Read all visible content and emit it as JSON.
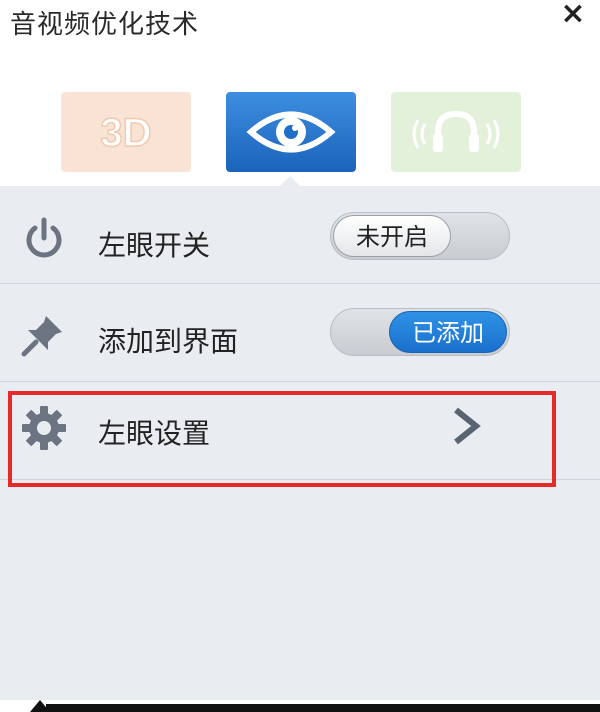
{
  "window": {
    "title": "音视频优化技术",
    "close_label": "×"
  },
  "tabs": [
    {
      "name": "3d-tab",
      "icon": "3d-icon",
      "label": "3D",
      "selected": false,
      "color": "#f9e3d4"
    },
    {
      "name": "eye-tab",
      "icon": "eye-icon",
      "selected": true,
      "color": "#1f6fc8"
    },
    {
      "name": "audio-tab",
      "icon": "headphones-icon",
      "selected": false,
      "color": "#e3f1da"
    }
  ],
  "settings": [
    {
      "label": "左眼开关",
      "icon": "power-icon",
      "control": "toggle",
      "state": "off",
      "toggle_text": "未开启"
    },
    {
      "label": "添加到界面",
      "icon": "pin-icon",
      "control": "toggle",
      "state": "on",
      "toggle_text": "已添加"
    },
    {
      "label": "左眼设置",
      "icon": "gear-icon",
      "control": "chevron",
      "chevron_icon": "chevron-right-icon"
    }
  ],
  "colors": {
    "accent": "#1b6fcc",
    "panel_bg": "#e9edf1",
    "highlight_border": "#e62a2a"
  }
}
